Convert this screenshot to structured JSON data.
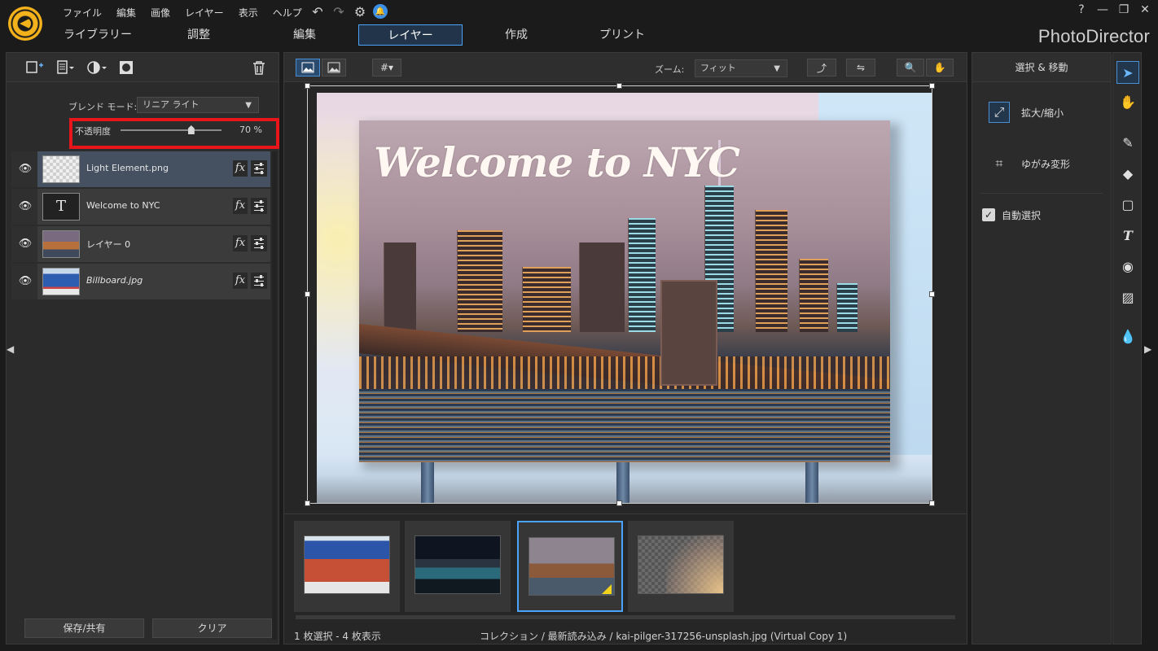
{
  "app": {
    "brand": "PhotoDirector"
  },
  "menubar": [
    "ファイル",
    "編集",
    "画像",
    "レイヤー",
    "表示",
    "ヘルプ"
  ],
  "window_controls": [
    "?",
    "—",
    "❐",
    "✕"
  ],
  "tabs": [
    {
      "label": "ライブラリー",
      "active": false
    },
    {
      "label": "調整",
      "active": false
    },
    {
      "label": "編集",
      "active": false
    },
    {
      "label": "レイヤー",
      "active": true
    },
    {
      "label": "作成",
      "active": false
    },
    {
      "label": "プリント",
      "active": false
    }
  ],
  "layers_panel": {
    "blend_mode_label": "ブレンド モード:",
    "blend_mode_value": "リニア ライト",
    "opacity_label": "不透明度",
    "opacity_value": 70,
    "opacity_text": "70 %",
    "layers": [
      {
        "name": "Light Element.png",
        "type": "image",
        "selected": true,
        "italic": false
      },
      {
        "name": "Welcome to NYC",
        "type": "text",
        "thumb_text": "T",
        "selected": false,
        "italic": false
      },
      {
        "name": "レイヤー 0",
        "type": "image",
        "selected": false,
        "italic": false
      },
      {
        "name": "Billboard.jpg",
        "type": "image",
        "selected": false,
        "italic": true
      }
    ],
    "fx_label": "fx",
    "save_share": "保存/共有",
    "clear": "クリア"
  },
  "canvas": {
    "zoom_label": "ズーム:",
    "zoom_value": "フィット",
    "title_text": "Welcome to NYC"
  },
  "status": {
    "count": "1 枚選択 - 4 枚表示",
    "path": "コレクション / 最新読み込み / kai-pilger-317256-unsplash.jpg (Virtual Copy 1)"
  },
  "filmstrip": [
    {
      "id": "utah",
      "selected": false
    },
    {
      "id": "nyc-night",
      "selected": false
    },
    {
      "id": "nyc-art",
      "selected": true
    },
    {
      "id": "light-element",
      "selected": false
    }
  ],
  "right_panel": {
    "title": "選択 & 移動",
    "items": [
      "拡大/縮小",
      "ゆがみ変形"
    ],
    "auto_select": "自動選択",
    "auto_select_checked": true
  },
  "icons": {
    "undo": "undo-icon",
    "redo": "redo-icon",
    "settings": "gear-icon",
    "notification": "bell-icon"
  }
}
